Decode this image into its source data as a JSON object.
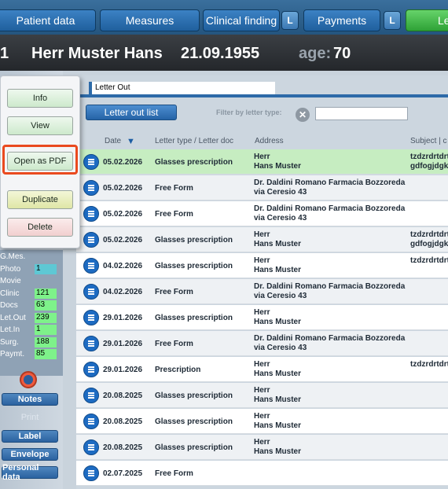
{
  "topbar": {
    "tabs": [
      "Patient data",
      "Measures",
      "Clinical finding",
      "Payments",
      "Le"
    ],
    "badges": [
      "L",
      "L"
    ]
  },
  "patient": {
    "id_fragment": "1",
    "name": "Herr Muster Hans",
    "birthdate": "21.09.1955",
    "age_label": "age:",
    "age_value": "70"
  },
  "sidebar": {
    "stats": [
      {
        "label": "G.Mes.",
        "value": "",
        "color": ""
      },
      {
        "label": "Photo",
        "value": "1",
        "color": "#5ec8d4"
      },
      {
        "label": "Movie",
        "value": "",
        "color": ""
      },
      {
        "label": "Clinic",
        "value": "121",
        "color": "#7ef28a"
      },
      {
        "label": "Docs",
        "value": "63",
        "color": "#7ef28a"
      },
      {
        "label": "Let.Out",
        "value": "239",
        "color": "#7ef28a"
      },
      {
        "label": "Let.In",
        "value": "1",
        "color": "#7ef28a"
      },
      {
        "label": "Surg.",
        "value": "188",
        "color": "#7ef28a"
      },
      {
        "label": "Paymt.",
        "value": "85",
        "color": "#7ef28a"
      }
    ],
    "notes": "Notes",
    "print": "Print",
    "label": "Label",
    "envelope": "Envelope",
    "personal": "Personal data"
  },
  "popup": {
    "info": "Info",
    "view": "View",
    "open_pdf": "Open as PDF",
    "duplicate": "Duplicate",
    "delete": "Delete"
  },
  "main": {
    "title": "Letter Out",
    "list_button": "Letter out list",
    "filter_label": "Filter by letter type:",
    "filter_value": "",
    "columns": {
      "date": "Date",
      "type": "Letter type / Letter doc",
      "address": "Address",
      "subject": "Subject | c"
    },
    "rows": [
      {
        "date": "05.02.2026",
        "type": "Glasses prescription",
        "address": "Herr\nHans Muster",
        "subject": "tzdzrdrtdrt\ngdfogjdgkö"
      },
      {
        "date": "05.02.2026",
        "type": "Free Form",
        "address": "Dr. Daldini Romano Farmacia Bozzoreda\nvia Ceresio 43",
        "subject": ""
      },
      {
        "date": "05.02.2026",
        "type": "Free Form",
        "address": "Dr. Daldini Romano Farmacia Bozzoreda\nvia Ceresio 43",
        "subject": ""
      },
      {
        "date": "05.02.2026",
        "type": "Glasses prescription",
        "address": "Herr\nHans Muster",
        "subject": "tzdzrdrtdrt\ngdfogjdgkö"
      },
      {
        "date": "04.02.2026",
        "type": "Glasses prescription",
        "address": "Herr\nHans Muster",
        "subject": "tzdzrdrtdrt"
      },
      {
        "date": "04.02.2026",
        "type": "Free Form",
        "address": "Dr. Daldini Romano Farmacia Bozzoreda\nvia Ceresio 43",
        "subject": ""
      },
      {
        "date": "29.01.2026",
        "type": "Glasses prescription",
        "address": "Herr\nHans Muster",
        "subject": ""
      },
      {
        "date": "29.01.2026",
        "type": "Free Form",
        "address": "Dr. Daldini Romano Farmacia Bozzoreda\nvia Ceresio 43",
        "subject": ""
      },
      {
        "date": "29.01.2026",
        "type": "Prescription",
        "address": "Herr\nHans Muster",
        "subject": "tzdzrdrtdrt"
      },
      {
        "date": "20.08.2025",
        "type": "Glasses prescription",
        "address": "Herr\nHans Muster",
        "subject": ""
      },
      {
        "date": "20.08.2025",
        "type": "Glasses prescription",
        "address": "Herr\nHans Muster",
        "subject": ""
      },
      {
        "date": "20.08.2025",
        "type": "Glasses prescription",
        "address": "Herr\nHans Muster",
        "subject": ""
      },
      {
        "date": "02.07.2025",
        "type": "Free Form",
        "address": "",
        "subject": ""
      }
    ]
  }
}
